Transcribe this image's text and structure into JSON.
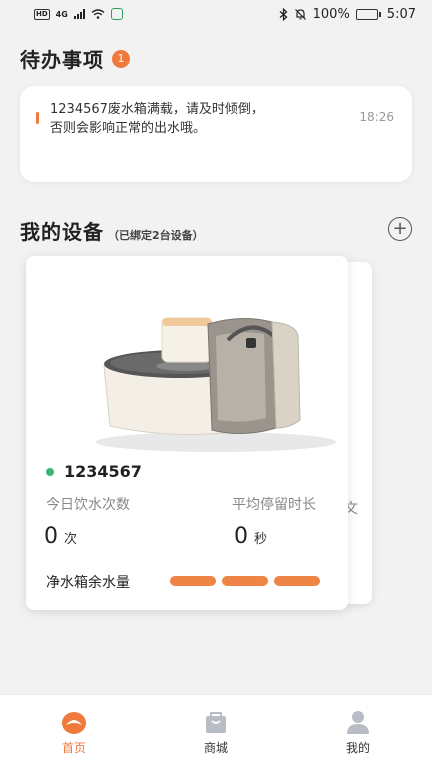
{
  "statusbar": {
    "network": "4G",
    "battery": "100%",
    "time": "5:07"
  },
  "todo": {
    "title": "待办事项",
    "count": "1",
    "message_line1": "1234567废水箱满载，请及时倾倒，",
    "message_line2": "否则会影响正常的出水哦。",
    "time": "18:26"
  },
  "devices": {
    "title": "我的设备",
    "subtitle": "（已绑定2台设备）",
    "card": {
      "name": "1234567",
      "online_color": "#3cb371",
      "drink_label": "今日饮水次数",
      "drink_value": "0",
      "drink_unit": "次",
      "stay_label": "平均停留时长",
      "stay_value": "0",
      "stay_unit": "秒",
      "water_label": "净水箱余水量",
      "water_level_segments_filled": 3,
      "water_level_segments_total": 3
    },
    "next_card_peek": "文"
  },
  "tabs": [
    {
      "label": "首页",
      "icon": "home-icon",
      "active": true
    },
    {
      "label": "商城",
      "icon": "shopping-bag-icon",
      "active": false
    },
    {
      "label": "我的",
      "icon": "user-icon",
      "active": false
    }
  ],
  "colors": {
    "accent": "#f07a3c",
    "online": "#3cb371"
  }
}
